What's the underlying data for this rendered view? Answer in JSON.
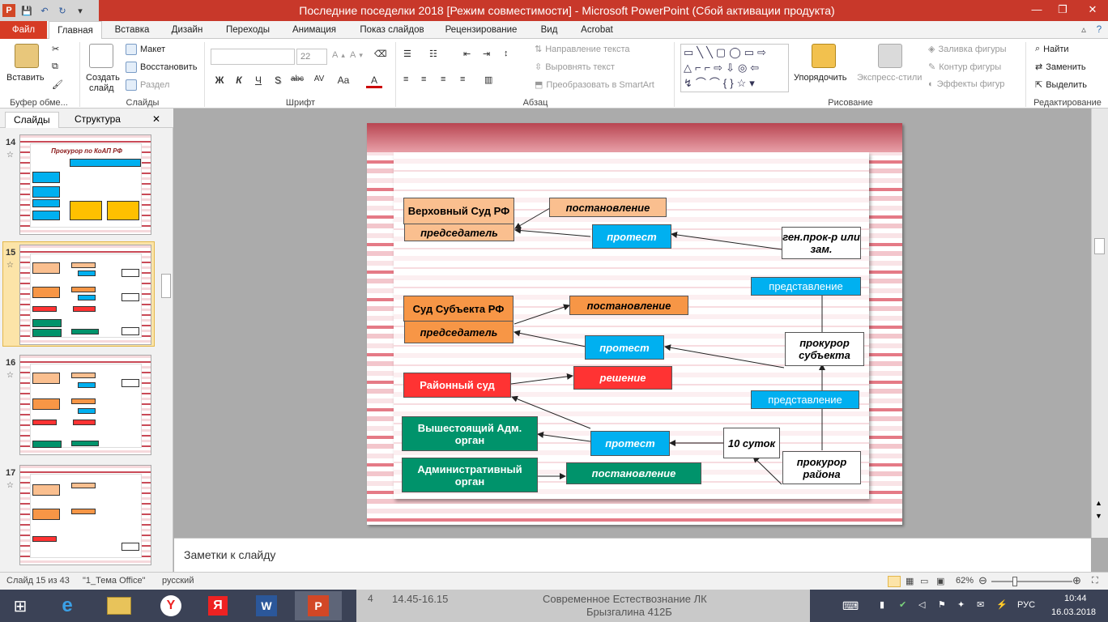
{
  "window": {
    "title": "Последние поседелки 2018 [Режим совместимости] - Microsoft PowerPoint (Сбой активации продукта)",
    "minimize": "—",
    "restore": "❐",
    "close": "✕"
  },
  "tabs": [
    "Файл",
    "Главная",
    "Вставка",
    "Дизайн",
    "Переходы",
    "Анимация",
    "Показ слайдов",
    "Рецензирование",
    "Вид",
    "Acrobat"
  ],
  "ribbon": {
    "clipboard": {
      "paste": "Вставить",
      "label": "Буфер обме..."
    },
    "slides": {
      "new_slide_1": "Создать",
      "new_slide_2": "слайд",
      "layout": "Макет",
      "reset": "Восстановить",
      "section": "Раздел",
      "label": "Слайды"
    },
    "font": {
      "size": "22",
      "label": "Шрифт",
      "bold": "Ж",
      "italic": "К",
      "underline": "Ч",
      "strike": "S",
      "abc": "abc",
      "spacing": "AV",
      "case": "Aa",
      "color": "A"
    },
    "paragraph": {
      "text_direction": "Направление текста",
      "align_text": "Выровнять текст",
      "smartart": "Преобразовать в SmartArt",
      "label": "Абзац"
    },
    "drawing": {
      "arrange": "Упорядочить",
      "quick_styles": "Экспресс-стили",
      "fill": "Заливка фигуры",
      "outline": "Контур фигуры",
      "effects": "Эффекты фигур",
      "label": "Рисование"
    },
    "editing": {
      "find": "Найти",
      "replace": "Заменить",
      "select": "Выделить",
      "label": "Редактирование"
    }
  },
  "left_panel": {
    "tab_slides": "Слайды",
    "tab_outline": "Структура",
    "close": "✕",
    "thumbs": [
      {
        "num": "14",
        "title": "Прокурор  по КоАП РФ"
      },
      {
        "num": "15",
        "title": ""
      },
      {
        "num": "16",
        "title": ""
      },
      {
        "num": "17",
        "title": ""
      }
    ]
  },
  "slide": {
    "supreme_court": "Верховный Суд РФ",
    "chairman_1": "председатель",
    "resolution_1": "постановление",
    "protest_1": "протест",
    "gen_prosecutor": "ген.прок-р или зам.",
    "submission_1": "представление",
    "subject_court": "Суд Субъекта РФ",
    "chairman_2": "председатель",
    "resolution_2": "постановление",
    "protest_2": "протест",
    "subject_prosecutor": "прокурор субъекта",
    "district_court": "Районный суд",
    "decision": "решение",
    "submission_2": "представление",
    "higher_admin": "Вышестоящий Адм. орган",
    "protest_3": "протест",
    "ten_days": "10 суток",
    "admin_body": "Административный орган",
    "resolution_3": "постановление",
    "district_prosecutor": "прокурор района"
  },
  "notes": {
    "placeholder": "Заметки к слайду"
  },
  "status": {
    "slide_of": "Слайд 15 из 43",
    "theme": "\"1_Тема Office\"",
    "language": "русский",
    "zoom": "62%"
  },
  "taskbar": {
    "lang": "РУС",
    "time": "10:44",
    "date": "16.03.2018",
    "bg_text_1": "14.45-16.15",
    "bg_text_2": "Современное Естествознание ЛК",
    "bg_text_3": "Брызгалина 412Б",
    "bg_num": "4"
  }
}
